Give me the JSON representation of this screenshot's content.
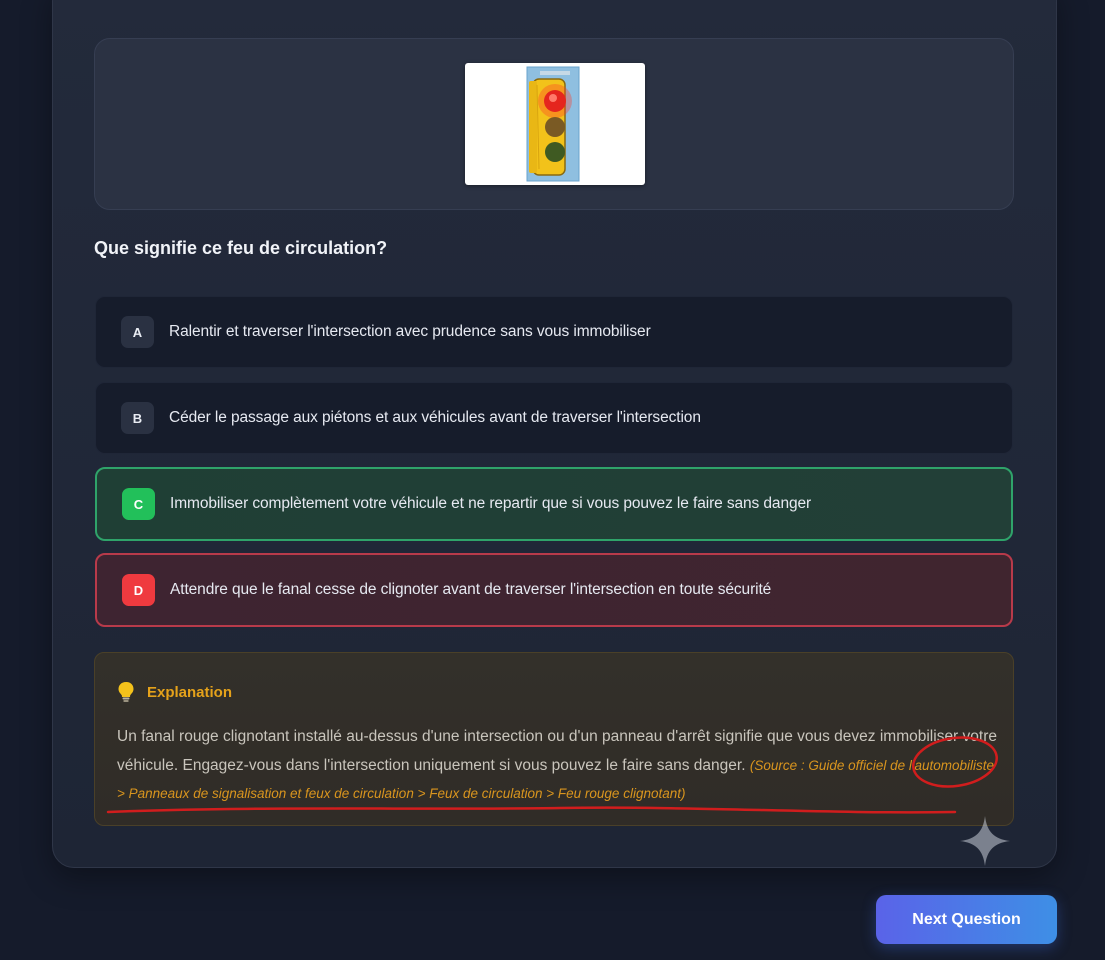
{
  "quiz": {
    "image": {
      "alt": "traffic-light-image"
    },
    "question": "Que signifie ce feu de circulation?",
    "options": [
      {
        "letter": "A",
        "text": "Ralentir et traverser l'intersection avec prudence sans vous immobiliser",
        "state": "neutral"
      },
      {
        "letter": "B",
        "text": "Céder le passage aux piétons et aux véhicules avant de traverser l'intersection",
        "state": "neutral"
      },
      {
        "letter": "C",
        "text": "Immobiliser complètement votre véhicule et ne repartir que si vous pouvez le faire sans danger",
        "state": "correct"
      },
      {
        "letter": "D",
        "text": "Attendre que le fanal cesse de clignoter avant de traverser l'intersection en toute sécurité",
        "state": "wrong"
      }
    ],
    "explanation": {
      "icon": "lightbulb-icon",
      "title": "Explanation",
      "body": "Un fanal rouge clignotant installé au-dessus d'une intersection ou d'un panneau d'arrêt signifie que vous devez immobiliser votre véhicule. Engagez-vous dans l'intersection uniquement si vous pouvez le faire sans danger.",
      "source": "(Source : Guide officiel de l'automobiliste > Panneaux de signalisation et feux de circulation > Feux de circulation > Feu rouge clignotant)"
    },
    "next_button": "Next Question"
  },
  "colors": {
    "correct": "#22c05a",
    "wrong": "#ef3a3f",
    "accent_orange": "#e5a21a",
    "annotation_red": "#d11d1d"
  }
}
